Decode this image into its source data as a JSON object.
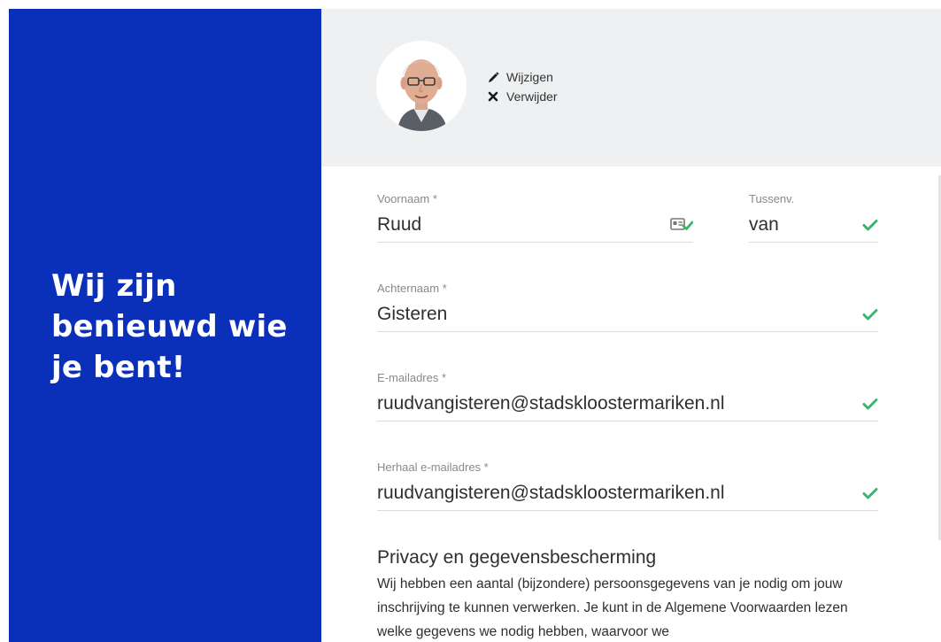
{
  "hero": {
    "heading": "Wij zijn benieuwd wie je bent!"
  },
  "photo": {
    "edit_label": "Wijzigen",
    "remove_label": "Verwijder"
  },
  "form": {
    "first_name": {
      "label": "Voornaam *",
      "value": "Ruud"
    },
    "infix": {
      "label": "Tussenv.",
      "value": "van"
    },
    "last_name": {
      "label": "Achternaam *",
      "value": "Gisteren"
    },
    "email": {
      "label": "E-mailadres *",
      "value": "ruudvangisteren@stadskloostermariken.nl"
    },
    "email_repeat": {
      "label": "Herhaal e-mailadres *",
      "value": "ruudvangisteren@stadskloostermariken.nl"
    }
  },
  "privacy": {
    "title": "Privacy en gegevensbescherming",
    "body": "Wij hebben een aantal (bijzondere) persoonsgegevens van je nodig om jouw inschrijving te kunnen verwerken. Je kunt in de Algemene Voorwaarden lezen welke gegevens we nodig hebben, waarvoor we"
  },
  "colors": {
    "brand_blue": "#0a2fb8",
    "valid_green": "#3cb371",
    "header_bg": "#eff0f2"
  },
  "icons": [
    "pencil-icon",
    "close-icon",
    "checkmark-icon",
    "id-card-check-icon"
  ]
}
